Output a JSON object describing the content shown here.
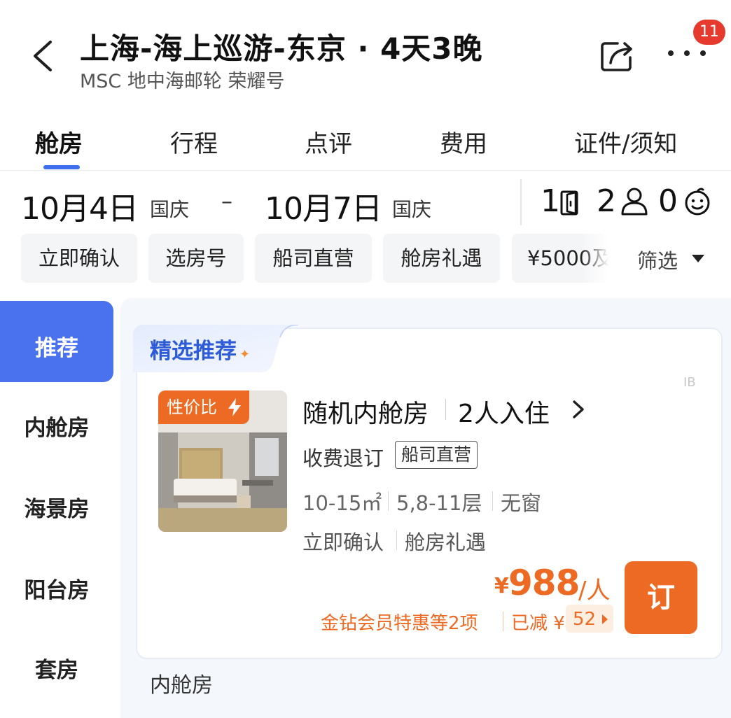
{
  "header": {
    "title": "上海-海上巡游-东京 · 4天3晚",
    "subtitle": "MSC 地中海邮轮 荣耀号",
    "badge_count": "11",
    "icons": [
      "chevron-left-icon",
      "share-icon",
      "more-icon"
    ]
  },
  "tabs": [
    {
      "label": "舱房",
      "active": true
    },
    {
      "label": "行程",
      "active": false
    },
    {
      "label": "点评",
      "active": false
    },
    {
      "label": "费用",
      "active": false
    },
    {
      "label": "证件/须知",
      "active": false
    }
  ],
  "dates": {
    "start": "10月4日",
    "start_tag": "国庆",
    "separator": "–",
    "end": "10月7日",
    "end_tag": "国庆"
  },
  "guests": {
    "rooms": "1",
    "adults": "2",
    "children": "0"
  },
  "filters": {
    "chips": [
      "立即确认",
      "选房号",
      "船司直营",
      "舱房礼遇",
      "¥5000及"
    ],
    "filter_label": "筛选"
  },
  "sidebar": {
    "items": [
      {
        "label": "推荐",
        "active": true
      },
      {
        "label": "内舱房",
        "active": false
      },
      {
        "label": "海景房",
        "active": false
      },
      {
        "label": "阳台房",
        "active": false
      },
      {
        "label": "套房",
        "active": false
      }
    ]
  },
  "card": {
    "section_tab": "精选推荐",
    "corner_mark": "IB",
    "badge": "性价比",
    "room_name": "随机内舱房",
    "occupancy": "2人入住",
    "refund_policy": "收费退订",
    "operator_tag": "船司直营",
    "specs": [
      "10-15㎡",
      "5,8-11层",
      "无窗"
    ],
    "features": [
      "立即确认",
      "舱房礼遇"
    ],
    "price_currency": "¥",
    "price": "988",
    "price_unit": "/人",
    "discount_text": "金钻会员特惠等2项",
    "reduced_label": "已减 ¥",
    "reduced_amount": "52",
    "book_label": "订"
  },
  "next_section": "内舱房",
  "colors": {
    "accent_blue": "#4a72ef",
    "accent_orange": "#ec6a23",
    "badge_red": "#e63a2e"
  }
}
